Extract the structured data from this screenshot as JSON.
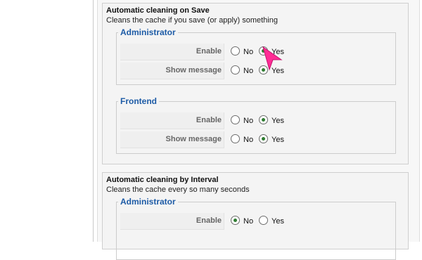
{
  "sections": [
    {
      "title": "Automatic cleaning on Save",
      "description": "Cleans the cache if you save (or apply) something",
      "groups": [
        {
          "legend": "Administrator",
          "rows": [
            {
              "label": "Enable",
              "options": [
                "No",
                "Yes"
              ],
              "selected": "Yes"
            },
            {
              "label": "Show message",
              "options": [
                "No",
                "Yes"
              ],
              "selected": "Yes"
            }
          ]
        },
        {
          "legend": "Frontend",
          "rows": [
            {
              "label": "Enable",
              "options": [
                "No",
                "Yes"
              ],
              "selected": "Yes"
            },
            {
              "label": "Show message",
              "options": [
                "No",
                "Yes"
              ],
              "selected": "Yes"
            }
          ]
        }
      ]
    },
    {
      "title": "Automatic cleaning by Interval",
      "description": "Cleans the cache every so many seconds",
      "groups": [
        {
          "legend": "Administrator",
          "rows": [
            {
              "label": "Enable",
              "options": [
                "No",
                "Yes"
              ],
              "selected": "No"
            }
          ]
        }
      ]
    }
  ],
  "colors": {
    "legend": "#1d5ba6",
    "radio_dot": "#2f7d32",
    "cursor": "#ff2d95"
  },
  "cursor_icon": "pointer-arrow-icon"
}
